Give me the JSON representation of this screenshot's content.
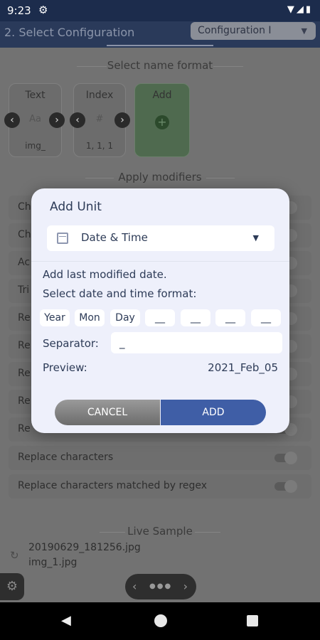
{
  "status": {
    "time": "9:23"
  },
  "header": {
    "title": "2. Select Configuration",
    "config": "Configuration I"
  },
  "name_format": {
    "title": "Select name format",
    "cards": [
      {
        "title": "Text",
        "icon": "Aa",
        "value": "img_"
      },
      {
        "title": "Index",
        "icon": "#",
        "value": "1, 1, 1"
      },
      {
        "title": "Add"
      }
    ]
  },
  "modifiers": {
    "title": "Apply modifiers",
    "rows": [
      "Ch",
      "Ch",
      "Ac",
      "Tri",
      "Re",
      "Re",
      "Re",
      "Re",
      "Re",
      "Replace characters",
      "Replace characters matched by regex"
    ]
  },
  "live_sample": {
    "title": "Live Sample",
    "items": [
      "20190629_181256.jpg",
      "img_1.jpg"
    ]
  },
  "dialog": {
    "title": "Add Unit",
    "unit": "Date & Time",
    "desc1": "Add last modified date.",
    "desc2": "Select date and time format:",
    "formats": [
      "Year",
      "Mon",
      "Day",
      "__",
      "__",
      "__",
      "__"
    ],
    "separator_label": "Separator:",
    "separator_value": "_",
    "preview_label": "Preview:",
    "preview_value": "2021_Feb_05",
    "cancel": "CANCEL",
    "add": "ADD"
  }
}
